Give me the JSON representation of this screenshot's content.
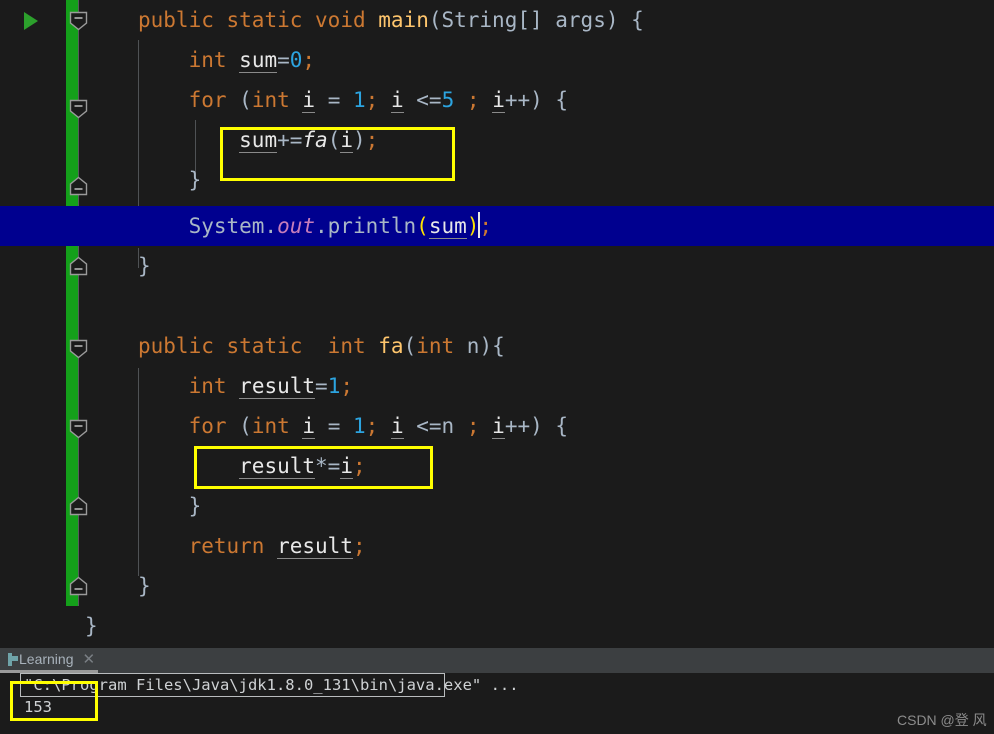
{
  "editor": {
    "run_gutter_icon": "run-arrow-icon",
    "intention_icon": "lightbulb-icon",
    "lines": [
      {
        "id": "line-main-decl",
        "indent": 0,
        "plain": "public static void main(String[] args) {"
      },
      {
        "id": "line-sum-decl",
        "indent": 1,
        "plain": "int sum=0;"
      },
      {
        "id": "line-for-outer",
        "indent": 1,
        "plain": "for (int i = 1; i <=5 ; i++) {"
      },
      {
        "id": "line-sum-accum",
        "indent": 2,
        "plain": "sum+=fa(i);"
      },
      {
        "id": "line-close-for-outer",
        "indent": 1,
        "plain": "}"
      },
      {
        "id": "line-println",
        "indent": 1,
        "plain": "System.out.println(sum);",
        "selected": true
      },
      {
        "id": "line-close-main",
        "indent": 0,
        "plain": "}"
      },
      {
        "id": "line-blank",
        "indent": 0,
        "plain": ""
      },
      {
        "id": "line-fa-decl",
        "indent": 0,
        "plain": "public static  int fa(int n){"
      },
      {
        "id": "line-result-decl",
        "indent": 1,
        "plain": "int result=1;"
      },
      {
        "id": "line-for-inner",
        "indent": 1,
        "plain": "for (int i = 1; i <=n ; i++) {"
      },
      {
        "id": "line-result-mult",
        "indent": 2,
        "plain": "result*=i;"
      },
      {
        "id": "line-close-for-inner",
        "indent": 1,
        "plain": "}"
      },
      {
        "id": "line-return",
        "indent": 1,
        "plain": "return result;"
      },
      {
        "id": "line-close-fa",
        "indent": 0,
        "plain": "}"
      },
      {
        "id": "line-close-class",
        "indent": 0,
        "plain": "}"
      }
    ],
    "annotations": [
      {
        "id": "highlight-sum-accum",
        "color": "#ffff00"
      },
      {
        "id": "highlight-result-mult",
        "color": "#ffff00"
      }
    ]
  },
  "toolwindow": {
    "tab": {
      "label": "Learning",
      "icon": "console-icon",
      "close_icon": "close-icon"
    },
    "console": {
      "command_line": "\"C:\\Program Files\\Java\\jdk1.8.0_131\\bin\\java.exe\" ...",
      "output_line": "153"
    }
  },
  "watermark": {
    "text": "CSDN @登 风"
  },
  "colors": {
    "background": "#1b1b1b",
    "selection": "#00008f",
    "keyword": "#cc7832",
    "method": "#ffc66d",
    "number": "#2ca4e0",
    "static_field": "#c77dbb",
    "matched_paren": "#ffe400",
    "vcs_modified": "#14a01a",
    "annotation": "#ffff00",
    "toolbar": "#3c3f41"
  }
}
